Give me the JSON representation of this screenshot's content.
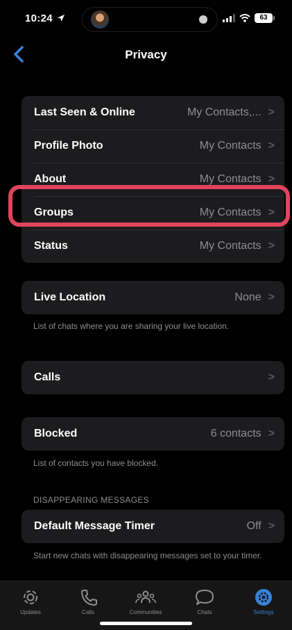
{
  "status_bar": {
    "time": "10:24",
    "battery": "63"
  },
  "nav": {
    "title": "Privacy"
  },
  "group1": [
    {
      "label": "Last Seen & Online",
      "value": "My Contacts,..."
    },
    {
      "label": "Profile Photo",
      "value": "My Contacts"
    },
    {
      "label": "About",
      "value": "My Contacts"
    },
    {
      "label": "Groups",
      "value": "My Contacts"
    },
    {
      "label": "Status",
      "value": "My Contacts"
    }
  ],
  "live_location": {
    "label": "Live Location",
    "value": "None",
    "footnote": "List of chats where you are sharing your live location."
  },
  "calls": {
    "label": "Calls"
  },
  "blocked": {
    "label": "Blocked",
    "value": "6 contacts",
    "footnote": "List of contacts you have blocked."
  },
  "disappearing": {
    "header": "DISAPPEARING MESSAGES",
    "label": "Default Message Timer",
    "value": "Off",
    "footnote": "Start new chats with disappearing messages set to your timer."
  },
  "tabs": [
    {
      "label": "Updates",
      "icon": "updates-icon"
    },
    {
      "label": "Calls",
      "icon": "phone-icon"
    },
    {
      "label": "Communities",
      "icon": "communities-icon"
    },
    {
      "label": "Chats",
      "icon": "chat-bubble-icon"
    },
    {
      "label": "Settings",
      "icon": "gear-icon",
      "active": true
    }
  ],
  "colors": {
    "highlight": "#e0455c",
    "accent": "#3b82d6",
    "cell": "#1c1c1e"
  }
}
